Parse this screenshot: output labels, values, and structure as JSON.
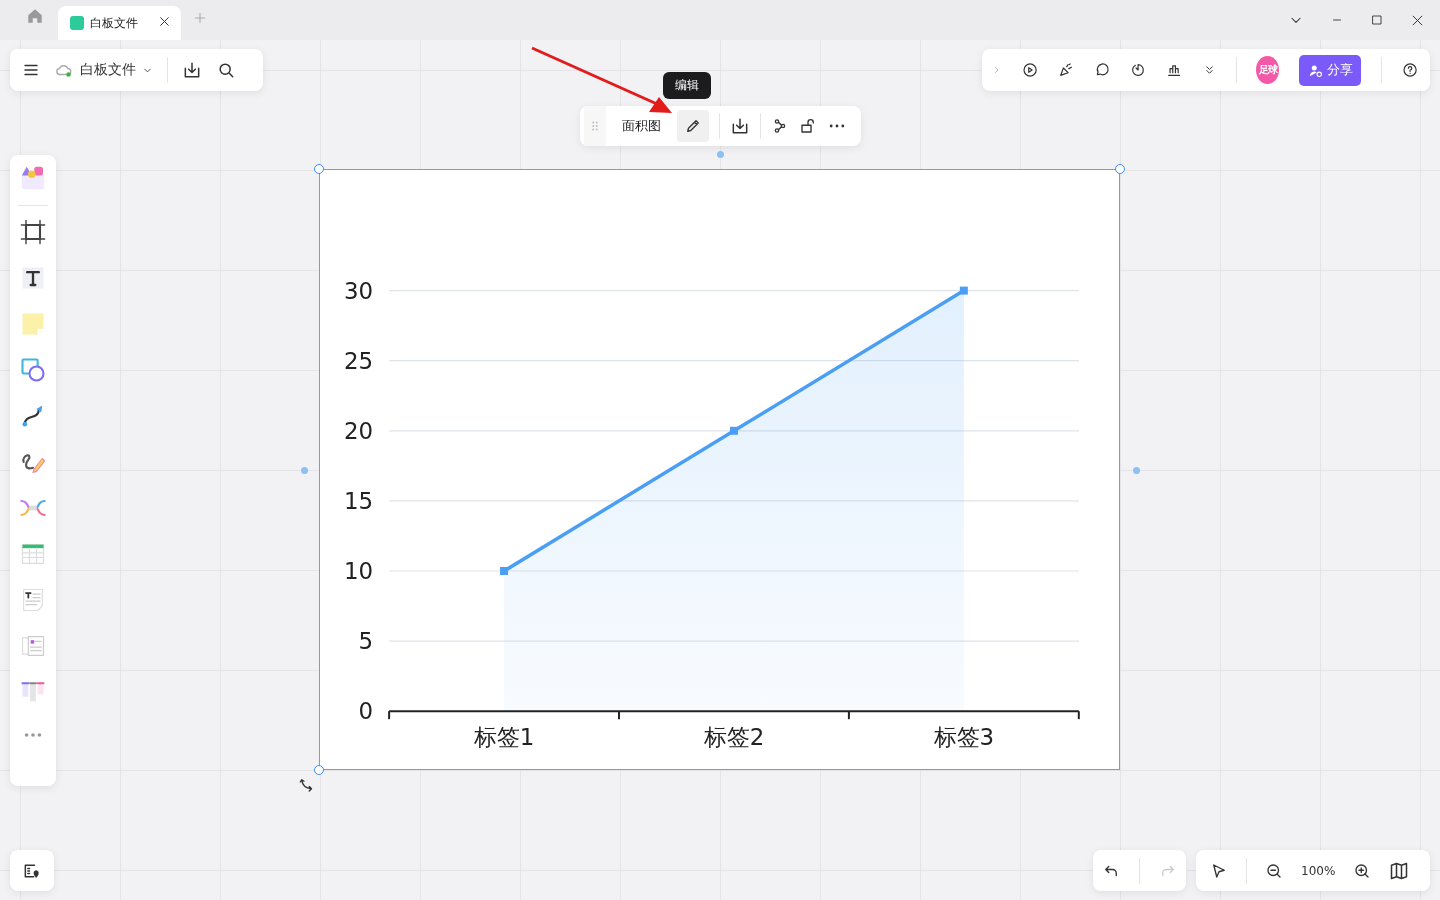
{
  "titlebar": {
    "tabs": [
      {
        "label": "白板文件",
        "selected": true
      }
    ]
  },
  "file_toolbar": {
    "file_name": "白板文件"
  },
  "top_right_toolbar": {
    "avatar": "足球",
    "share_button": "分享"
  },
  "selection_toolbar": {
    "type_label": "面积图",
    "tooltip": "编辑"
  },
  "chart": {
    "chart_data": {
      "type": "area",
      "categories": [
        "标签1",
        "标签2",
        "标签3"
      ],
      "series": [
        {
          "color": "#4a9ff5",
          "values": [
            10,
            20,
            30
          ]
        }
      ],
      "grid": true,
      "ylim": [
        0,
        30
      ],
      "yticks": [
        0,
        5,
        10,
        15,
        20,
        25,
        30
      ]
    }
  },
  "zoom_toolbar": {
    "zoom": "100%"
  }
}
